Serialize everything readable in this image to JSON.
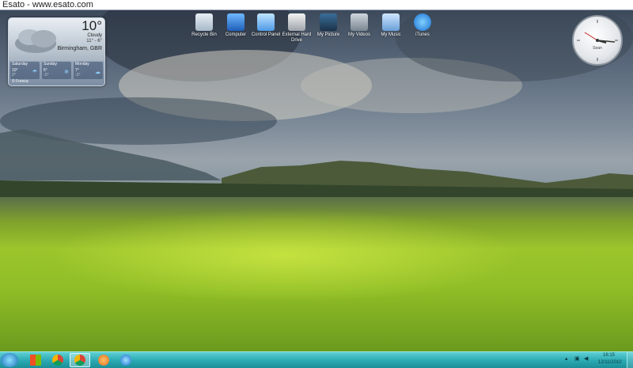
{
  "window": {
    "title": "Esato - www.esato.com"
  },
  "desktop_icons": [
    {
      "label": "Recycle Bin",
      "icon": "recycle-bin-icon"
    },
    {
      "label": "Computer",
      "icon": "computer-icon"
    },
    {
      "label": "Control Panel",
      "icon": "control-panel-icon"
    },
    {
      "label": "External Hard Drive",
      "icon": "external-drive-icon"
    },
    {
      "label": "My Picture",
      "icon": "pictures-icon"
    },
    {
      "label": "My Videos",
      "icon": "videos-icon"
    },
    {
      "label": "My Music",
      "icon": "music-icon"
    },
    {
      "label": "iTunes",
      "icon": "itunes-icon"
    }
  ],
  "weather": {
    "temp": "10°",
    "condition": "Cloudy",
    "hilo": "11° - 6°",
    "city": "Birmingham, GBR",
    "provider": "© Foreca",
    "forecast": [
      {
        "day": "Saturday",
        "hi": "10°",
        "lo": "2°"
      },
      {
        "day": "Sunday",
        "hi": "6°",
        "lo": "-1°"
      },
      {
        "day": "Monday",
        "hi": "7°",
        "lo": "-1°"
      }
    ]
  },
  "clock": {
    "label": "Sean"
  },
  "taskbar": {
    "items": [
      "start-orb-icon",
      "windows-live-icon",
      "chrome-icon",
      "chrome-active-icon",
      "firefox-like-icon",
      "itunes-icon"
    ],
    "time": "16:15",
    "date": "12/11/2010"
  },
  "colors": {
    "taskbar": "#2aa8b1",
    "grass": "#9cc52c",
    "sky": "#5d6c7e"
  }
}
